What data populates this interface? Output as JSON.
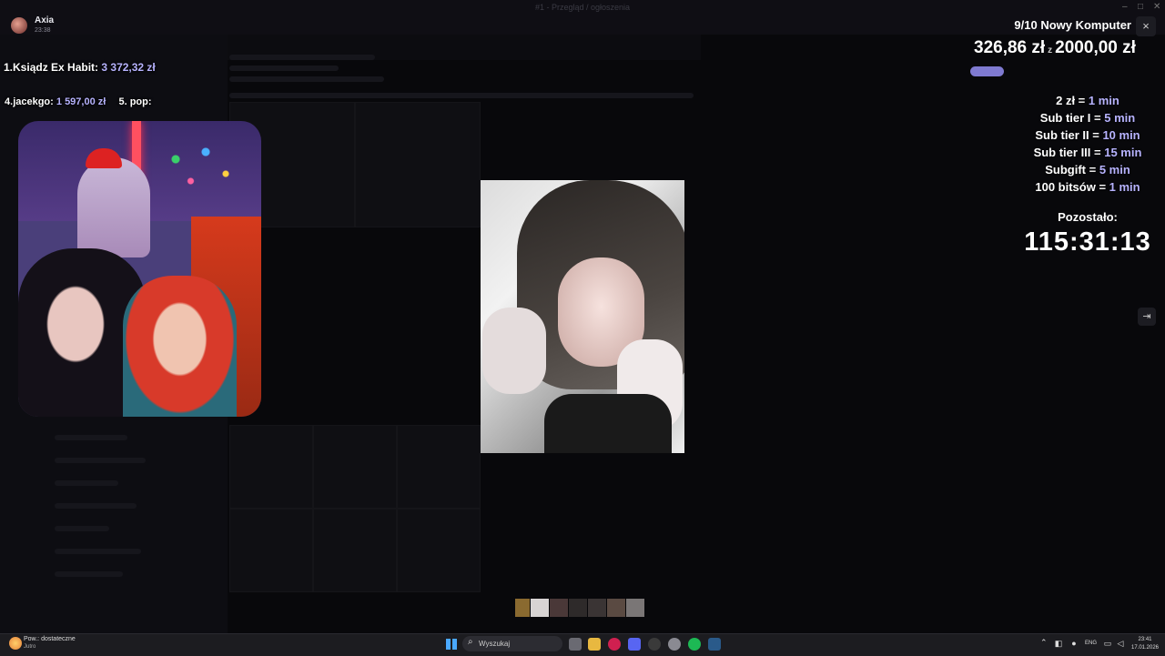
{
  "window": {
    "title": "#1 - Przegląd / ogłoszenia"
  },
  "post": {
    "author": "Axia",
    "time": "23:38"
  },
  "leaderboard": {
    "first": {
      "rank": "1.",
      "name": "Ksiądz Ex Habit:",
      "amount": "3 372,32 zł"
    },
    "fourth": {
      "rank": "4.",
      "name": "jacekgo:",
      "amount": "1 597,00 zł"
    },
    "fifth": {
      "rank": "5.",
      "name": "pop:"
    }
  },
  "goal": {
    "title": "9/10 Nowy Komputer",
    "current": "326,86 zł",
    "separator": "z",
    "target": "2000,00 zł",
    "progress_fraction": 0.163
  },
  "tiers": [
    {
      "label": "2 zł =",
      "value": "1 min"
    },
    {
      "label": "Sub tier I =",
      "value": "5 min"
    },
    {
      "label": "Sub tier II =",
      "value": "10 min"
    },
    {
      "label": "Sub tier III =",
      "value": "15 min"
    },
    {
      "label": "Subgift =",
      "value": "5 min"
    },
    {
      "label": "100 bitsów =",
      "value": "1 min"
    }
  ],
  "timer": {
    "label": "Pozostało:",
    "value": "115:31:13"
  },
  "overlay": {
    "close_icon": "×",
    "side_icon": "⇥"
  },
  "taskbar": {
    "weather_title": "Pow.: dostateczne",
    "weather_sub": "Jutro",
    "search_placeholder": "Wyszukaj",
    "lang": "ENG",
    "time": "23:41",
    "date": "17.01.2026"
  },
  "colors": {
    "accent": "#b7b3ff",
    "progress": "#7f7ad1"
  }
}
